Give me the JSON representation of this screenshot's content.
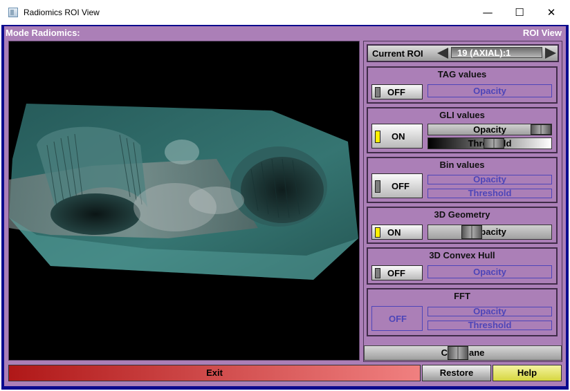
{
  "window": {
    "title": "Radiomics ROI View",
    "minimize_glyph": "—",
    "maximize_glyph": "☐",
    "close_glyph": "✕"
  },
  "header": {
    "mode_label": "Mode Radiomics:",
    "view_label": "ROI View"
  },
  "roi": {
    "label": "Current ROI",
    "value": "19 (AXIAL):1"
  },
  "panels": {
    "tag": {
      "title": "TAG values",
      "toggle": "OFF",
      "opacity": "Opacity"
    },
    "gli": {
      "title": "GLI values",
      "toggle": "ON",
      "opacity": "Opacity",
      "threshold": "Threshold"
    },
    "bin": {
      "title": "Bin values",
      "toggle": "OFF",
      "opacity": "Opacity",
      "threshold": "Threshold"
    },
    "geometry": {
      "title": "3D Geometry",
      "toggle": "ON",
      "opacity": "Opacity"
    },
    "hull": {
      "title": "3D Convex Hull",
      "toggle": "OFF",
      "opacity": "Opacity"
    },
    "fft": {
      "title": "FFT",
      "toggle": "OFF",
      "opacity": "Opacity",
      "threshold": "Threshold"
    }
  },
  "clip": {
    "label": "Clip Plane"
  },
  "buttons": {
    "exit": "Exit",
    "restore": "Restore",
    "help": "Help"
  },
  "colors": {
    "panel_bg": "#ab7fb7",
    "frame": "#0b0b8e",
    "disabled_text": "#4d45b8",
    "on_indicator": "#ffef00"
  }
}
